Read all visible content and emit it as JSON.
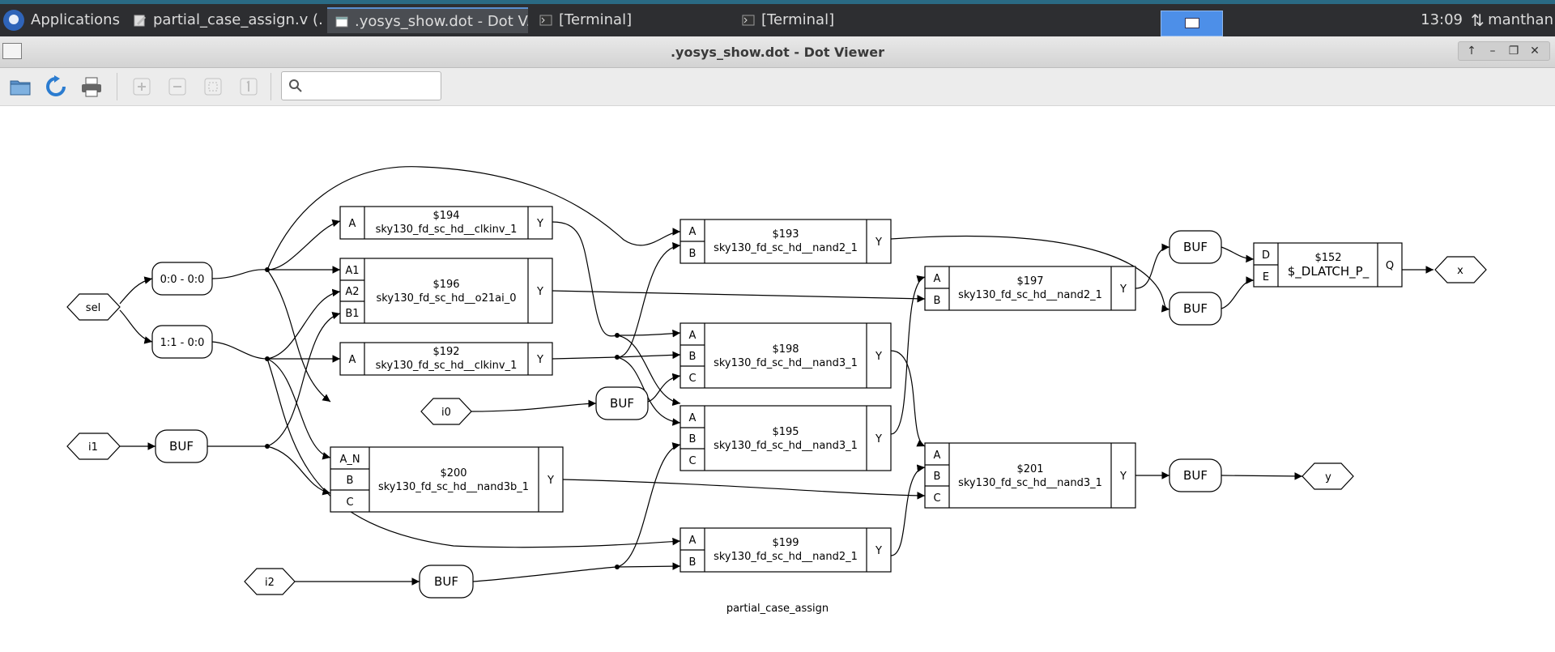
{
  "taskbar": {
    "applications_label": "Applications",
    "tasks": [
      {
        "label": "partial_case_assign.v (..."
      },
      {
        "label": ".yosys_show.dot - Dot V..."
      },
      {
        "label": "[Terminal]"
      },
      {
        "label": "[Terminal]"
      }
    ],
    "clock": "13:09",
    "user": "manthan"
  },
  "window": {
    "title": ".yosys_show.dot - Dot Viewer"
  },
  "toolbar": {
    "search_value": "",
    "icons": [
      "open-folder-icon",
      "reload-icon",
      "print-icon",
      "zoom-in-icon",
      "zoom-out-icon",
      "zoom-fit-icon",
      "zoom-100-icon"
    ]
  },
  "graph": {
    "caption": "partial_case_assign",
    "inputs": {
      "sel": "sel",
      "i0": "i0",
      "i1": "i1",
      "i2": "i2"
    },
    "outputs": {
      "x": "x",
      "y": "y"
    },
    "slices": {
      "s0": "0:0 - 0:0",
      "s1": "1:1 - 0:0"
    },
    "buf_label": "BUF",
    "cells": {
      "c194": {
        "id": "$194",
        "type": "sky130_fd_sc_hd__clkinv_1",
        "inputs": [
          "A"
        ],
        "output": "Y"
      },
      "c196": {
        "id": "$196",
        "type": "sky130_fd_sc_hd__o21ai_0",
        "inputs": [
          "A1",
          "A2",
          "B1"
        ],
        "output": "Y"
      },
      "c192": {
        "id": "$192",
        "type": "sky130_fd_sc_hd__clkinv_1",
        "inputs": [
          "A"
        ],
        "output": "Y"
      },
      "c200": {
        "id": "$200",
        "type": "sky130_fd_sc_hd__nand3b_1",
        "inputs": [
          "A_N",
          "B",
          "C"
        ],
        "output": "Y"
      },
      "c193": {
        "id": "$193",
        "type": "sky130_fd_sc_hd__nand2_1",
        "inputs": [
          "A",
          "B"
        ],
        "output": "Y"
      },
      "c198": {
        "id": "$198",
        "type": "sky130_fd_sc_hd__nand3_1",
        "inputs": [
          "A",
          "B",
          "C"
        ],
        "output": "Y"
      },
      "c195": {
        "id": "$195",
        "type": "sky130_fd_sc_hd__nand3_1",
        "inputs": [
          "A",
          "B",
          "C"
        ],
        "output": "Y"
      },
      "c199": {
        "id": "$199",
        "type": "sky130_fd_sc_hd__nand2_1",
        "inputs": [
          "A",
          "B"
        ],
        "output": "Y"
      },
      "c197": {
        "id": "$197",
        "type": "sky130_fd_sc_hd__nand2_1",
        "inputs": [
          "A",
          "B"
        ],
        "output": "Y"
      },
      "c201": {
        "id": "$201",
        "type": "sky130_fd_sc_hd__nand3_1",
        "inputs": [
          "A",
          "B",
          "C"
        ],
        "output": "Y"
      },
      "c152": {
        "id": "$152",
        "type": "$_DLATCH_P_",
        "inputs": [
          "D",
          "E"
        ],
        "output": "Q"
      }
    }
  }
}
